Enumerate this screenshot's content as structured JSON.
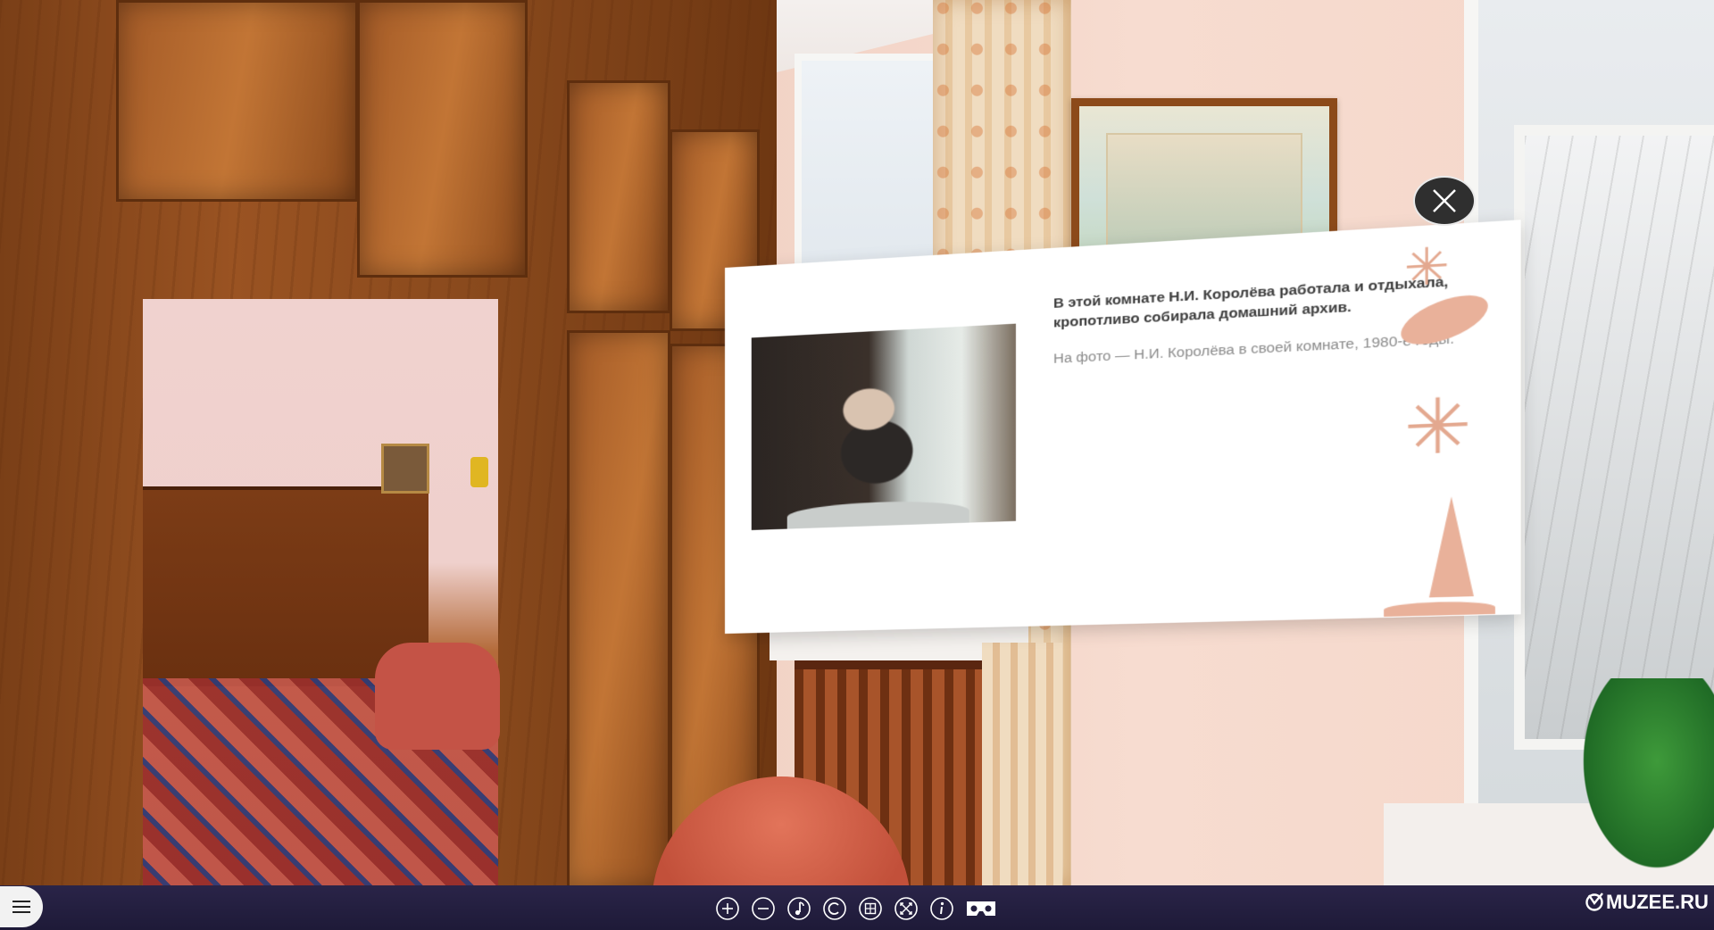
{
  "info_panel": {
    "main_text": "В этой комнате Н.И. Королёва работала и отдыхала, кропотливо собирала домашний архив.",
    "caption": "На фото — Н.И. Королёва в своей комнате, 1980-е годы."
  },
  "toolbar": {
    "icons": [
      "zoom-in",
      "zoom-out",
      "music",
      "copyright",
      "grid",
      "fullscreen",
      "info",
      "vr-headset"
    ]
  },
  "logo": {
    "text": "MUZEE.RU"
  },
  "colors": {
    "toolbar_bg": "#221d3f",
    "panel_bg": "#ffffff",
    "accent_deco": "#e3a88f"
  }
}
